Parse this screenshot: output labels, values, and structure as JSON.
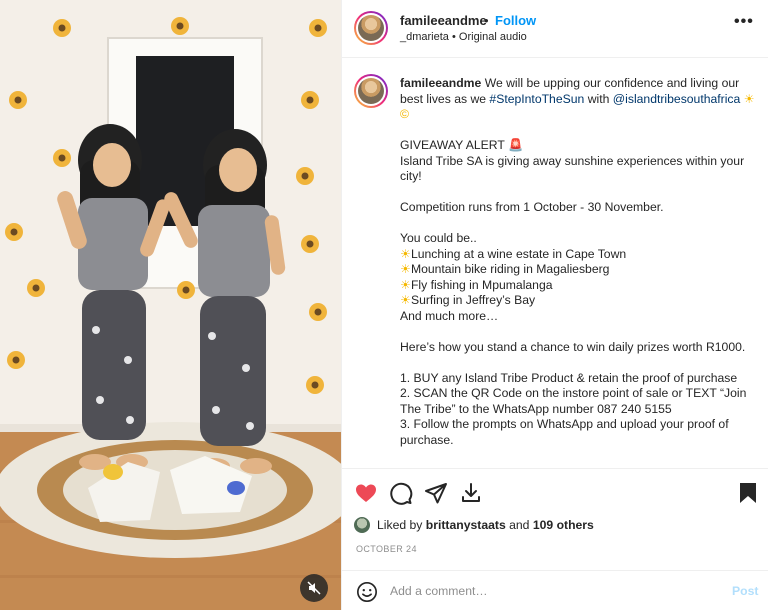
{
  "colors": {
    "accent": "#0095f6",
    "link": "#00376b",
    "like_red": "#ed4956",
    "muted": "#8e8e8e",
    "post_disabled": "#b2dffc"
  },
  "header": {
    "username": "famileeandme",
    "dot": "•",
    "follow_label": "Follow",
    "sub_user": "_dmarieta",
    "sub_sep": "•",
    "sub_audio": "Original audio",
    "more_label": "•••"
  },
  "caption": {
    "username": "famileeandme",
    "intro": "We will be upping our confidence and living our best lives as we",
    "hashtag": "#StepIntoTheSun",
    "with": "with",
    "mention": "@islandtribesouthafrica",
    "intro_emoji": "☀©",
    "giveaway": "GIVEAWAY ALERT",
    "giveaway_emoji": "🚨",
    "line_island": "Island Tribe SA is giving away sunshine experiences within your city!",
    "competition": "Competition runs from 1 October - 30 November.",
    "could_be": "You could be..",
    "sun": "☀",
    "items": [
      "Lunching at a wine estate in Cape Town",
      "Mountain bike riding in Magaliesberg",
      "Fly fishing in Mpumalanga",
      "Surfing in Jeffrey’s Bay"
    ],
    "much_more": "And much more…",
    "chance": "Here’s how you stand a chance to win daily prizes worth R1000.",
    "steps": [
      "1. BUY any Island Tribe Product & retain the proof of purchase",
      "2. SCAN the QR Code on the instore point of sale or TEXT “Join The Tribe” to the WhatsApp number 087 240 5155",
      "3. Follow the prompts on WhatsApp and upload your proof of purchase."
    ]
  },
  "actions": {
    "icons": [
      "heart-icon",
      "comment-icon",
      "share-icon",
      "save-icon"
    ],
    "liked": true
  },
  "likes": {
    "prefix": "Liked by",
    "user": "brittanystaats",
    "and": "and",
    "others": "109 others"
  },
  "date": "OCTOBER 24",
  "comment": {
    "placeholder": "Add a comment…",
    "post_label": "Post"
  },
  "media": {
    "muted": true
  }
}
